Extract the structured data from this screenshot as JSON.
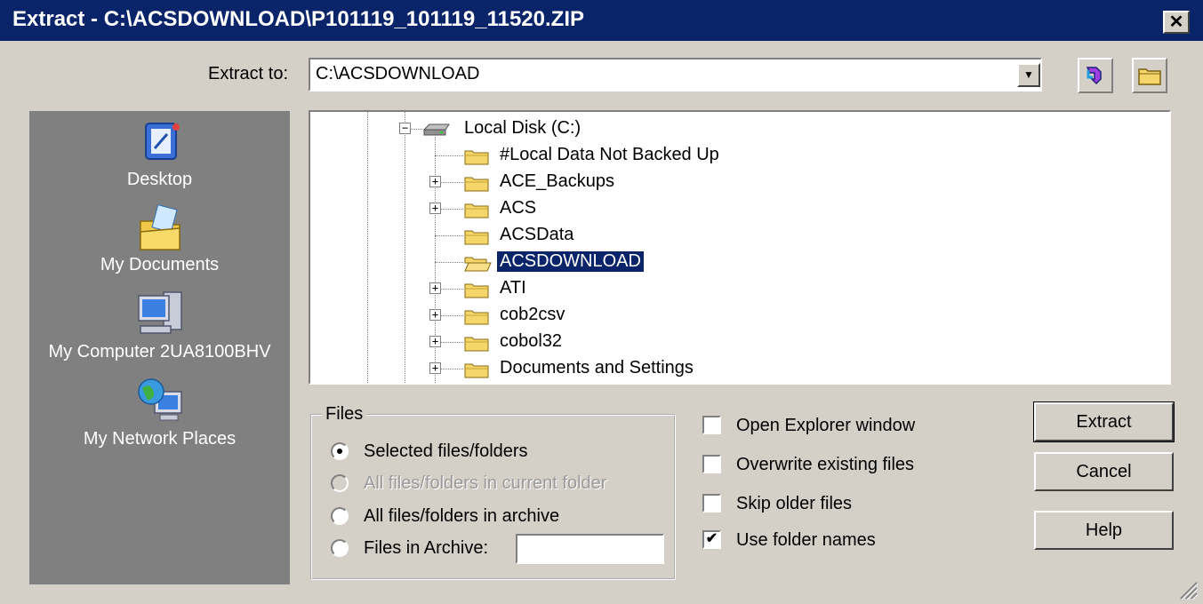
{
  "window": {
    "title": "Extract - C:\\ACSDOWNLOAD\\P101119_101119_11520.ZIP",
    "close_label": "✕"
  },
  "extract_to": {
    "label": "Extract to:",
    "value": "C:\\ACSDOWNLOAD"
  },
  "places": [
    {
      "label": "Desktop",
      "icon": "desktop-icon"
    },
    {
      "label": "My Documents",
      "icon": "my-documents-icon"
    },
    {
      "label": "My Computer 2UA8100BHV",
      "icon": "my-computer-icon"
    },
    {
      "label": "My Network Places",
      "icon": "my-network-places-icon"
    }
  ],
  "tree": {
    "root": "Local Disk (C:)",
    "items": [
      {
        "label": "#Local Data Not Backed Up",
        "expandable": false,
        "selected": false
      },
      {
        "label": "ACE_Backups",
        "expandable": true,
        "selected": false
      },
      {
        "label": "ACS",
        "expandable": true,
        "selected": false
      },
      {
        "label": "ACSData",
        "expandable": false,
        "selected": false
      },
      {
        "label": "ACSDOWNLOAD",
        "expandable": false,
        "selected": true
      },
      {
        "label": "ATI",
        "expandable": true,
        "selected": false
      },
      {
        "label": "cob2csv",
        "expandable": true,
        "selected": false
      },
      {
        "label": "cobol32",
        "expandable": true,
        "selected": false
      },
      {
        "label": "Documents and Settings",
        "expandable": true,
        "selected": false
      }
    ]
  },
  "files": {
    "legend": "Files",
    "options": [
      {
        "label": "Selected files/folders",
        "checked": true,
        "disabled": false
      },
      {
        "label": "All files/folders in current folder",
        "checked": false,
        "disabled": true
      },
      {
        "label": "All files/folders in archive",
        "checked": false,
        "disabled": false
      },
      {
        "label": "Files in Archive:",
        "checked": false,
        "disabled": false
      }
    ],
    "archive_value": ""
  },
  "options": [
    {
      "label": "Open Explorer window",
      "checked": false
    },
    {
      "label": "Overwrite existing files",
      "checked": false
    },
    {
      "label": "Skip older files",
      "checked": false
    },
    {
      "label": "Use folder names",
      "checked": true
    }
  ],
  "buttons": {
    "extract": "Extract",
    "cancel": "Cancel",
    "help": "Help"
  },
  "colors": {
    "title_bar": "#0a246a",
    "face": "#d4d0c8",
    "places_bg": "#808080",
    "selection": "#0a246a"
  }
}
